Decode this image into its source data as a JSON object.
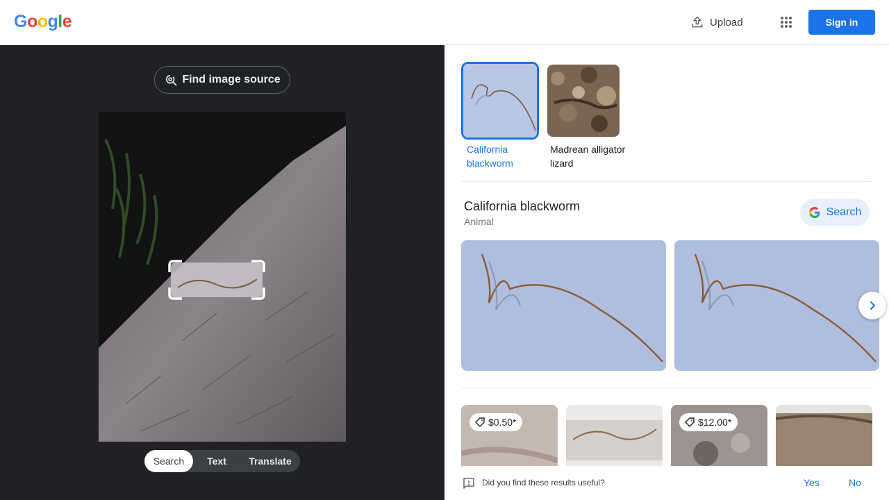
{
  "header": {
    "logo_letters": [
      {
        "char": "G",
        "color": "#4285f4"
      },
      {
        "char": "o",
        "color": "#ea4335"
      },
      {
        "char": "o",
        "color": "#fbbc05"
      },
      {
        "char": "g",
        "color": "#4285f4"
      },
      {
        "char": "l",
        "color": "#34a853"
      },
      {
        "char": "e",
        "color": "#ea4335"
      }
    ],
    "upload_label": "Upload",
    "upload_icon": "upload-icon",
    "apps_icon": "apps-grid-icon",
    "signin_label": "Sign in"
  },
  "left": {
    "find_source_label": "Find image source",
    "find_source_icon": "lens-search-icon",
    "modes": [
      {
        "label": "Search",
        "active": true
      },
      {
        "label": "Text",
        "active": false
      },
      {
        "label": "Translate",
        "active": false
      }
    ]
  },
  "right": {
    "matches": [
      {
        "label": "California blackworm",
        "selected": true
      },
      {
        "label": "Madrean alligator lizard",
        "selected": false
      }
    ],
    "knowledge_panel": {
      "title": "California blackworm",
      "subtitle": "Animal",
      "search_label": "Search"
    },
    "products": [
      {
        "price": "$0.50*"
      },
      {
        "price": ""
      },
      {
        "price": "$12.00*"
      },
      {
        "price": ""
      }
    ],
    "feedback": {
      "question": "Did you find these results useful?",
      "yes": "Yes",
      "no": "No"
    }
  },
  "colors": {
    "accent": "#1a73e8",
    "dark_bg": "#202124",
    "selected_chip_bg": "#e8f0fe"
  }
}
